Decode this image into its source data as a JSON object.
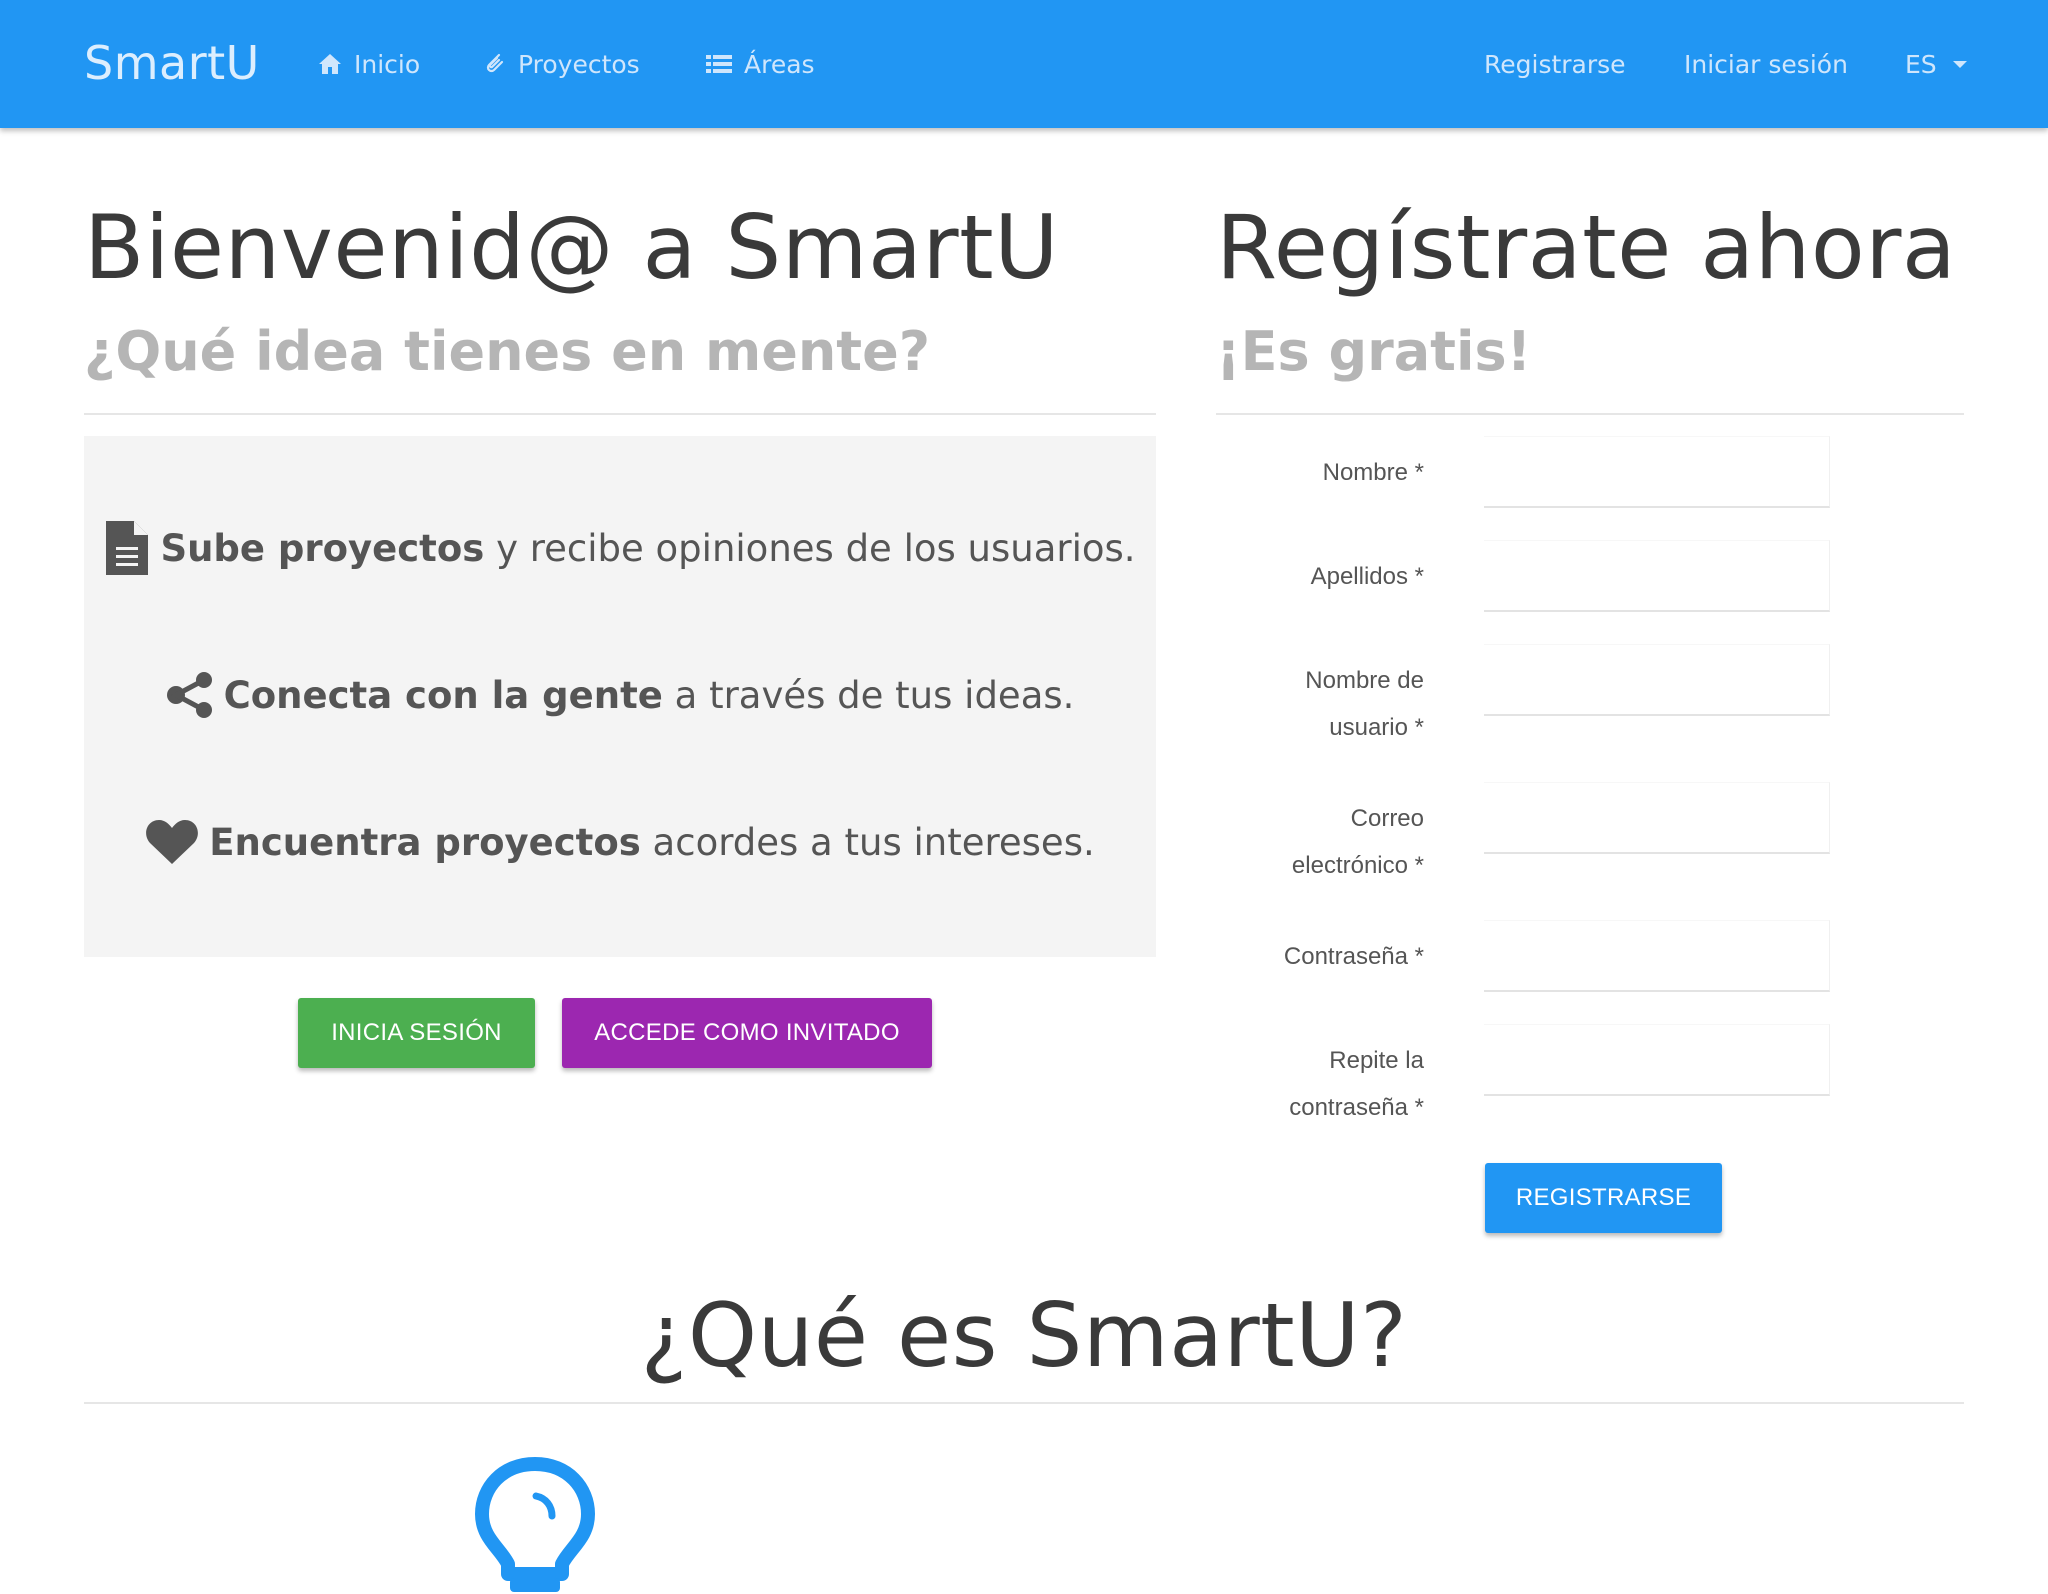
{
  "navbar": {
    "brand": "SmartU",
    "items": [
      {
        "label": "Inicio",
        "icon": "home-icon"
      },
      {
        "label": "Proyectos",
        "icon": "paperclip-icon"
      },
      {
        "label": "Áreas",
        "icon": "list-icon"
      }
    ],
    "right": {
      "register": "Registrarse",
      "login": "Iniciar sesión",
      "language": "ES"
    }
  },
  "welcome": {
    "title": "Bienvenid@ a SmartU",
    "subtitle": "¿Qué idea tienes en mente?",
    "features": [
      {
        "icon": "document-icon",
        "bold": "Sube proyectos",
        "text": " y recibe opiniones de los usuarios."
      },
      {
        "icon": "share-icon",
        "bold": "Conecta con la gente",
        "text": " a través de tus ideas."
      },
      {
        "icon": "heart-icon",
        "bold": "Encuentra proyectos",
        "text": " acordes a tus intereses."
      }
    ],
    "login_button": "INICIA SESIÓN",
    "guest_button": "ACCEDE COMO INVITADO"
  },
  "register": {
    "title": "Regístrate ahora",
    "subtitle": "¡Es gratis!",
    "fields": {
      "nombre": "Nombre *",
      "apellidos": "Apellidos *",
      "usuario_1": "Nombre de",
      "usuario_2": "usuario *",
      "correo_1": "Correo",
      "correo_2": "electrónico *",
      "password": "Contraseña *",
      "repeat_1": "Repite la",
      "repeat_2": "contraseña *"
    },
    "submit": "REGISTRARSE"
  },
  "about": {
    "title": "¿Qué es SmartU?",
    "icon": "lightbulb-icon"
  },
  "colors": {
    "primary": "#2196f3",
    "success": "#4caf50",
    "purple": "#9c27b0"
  }
}
